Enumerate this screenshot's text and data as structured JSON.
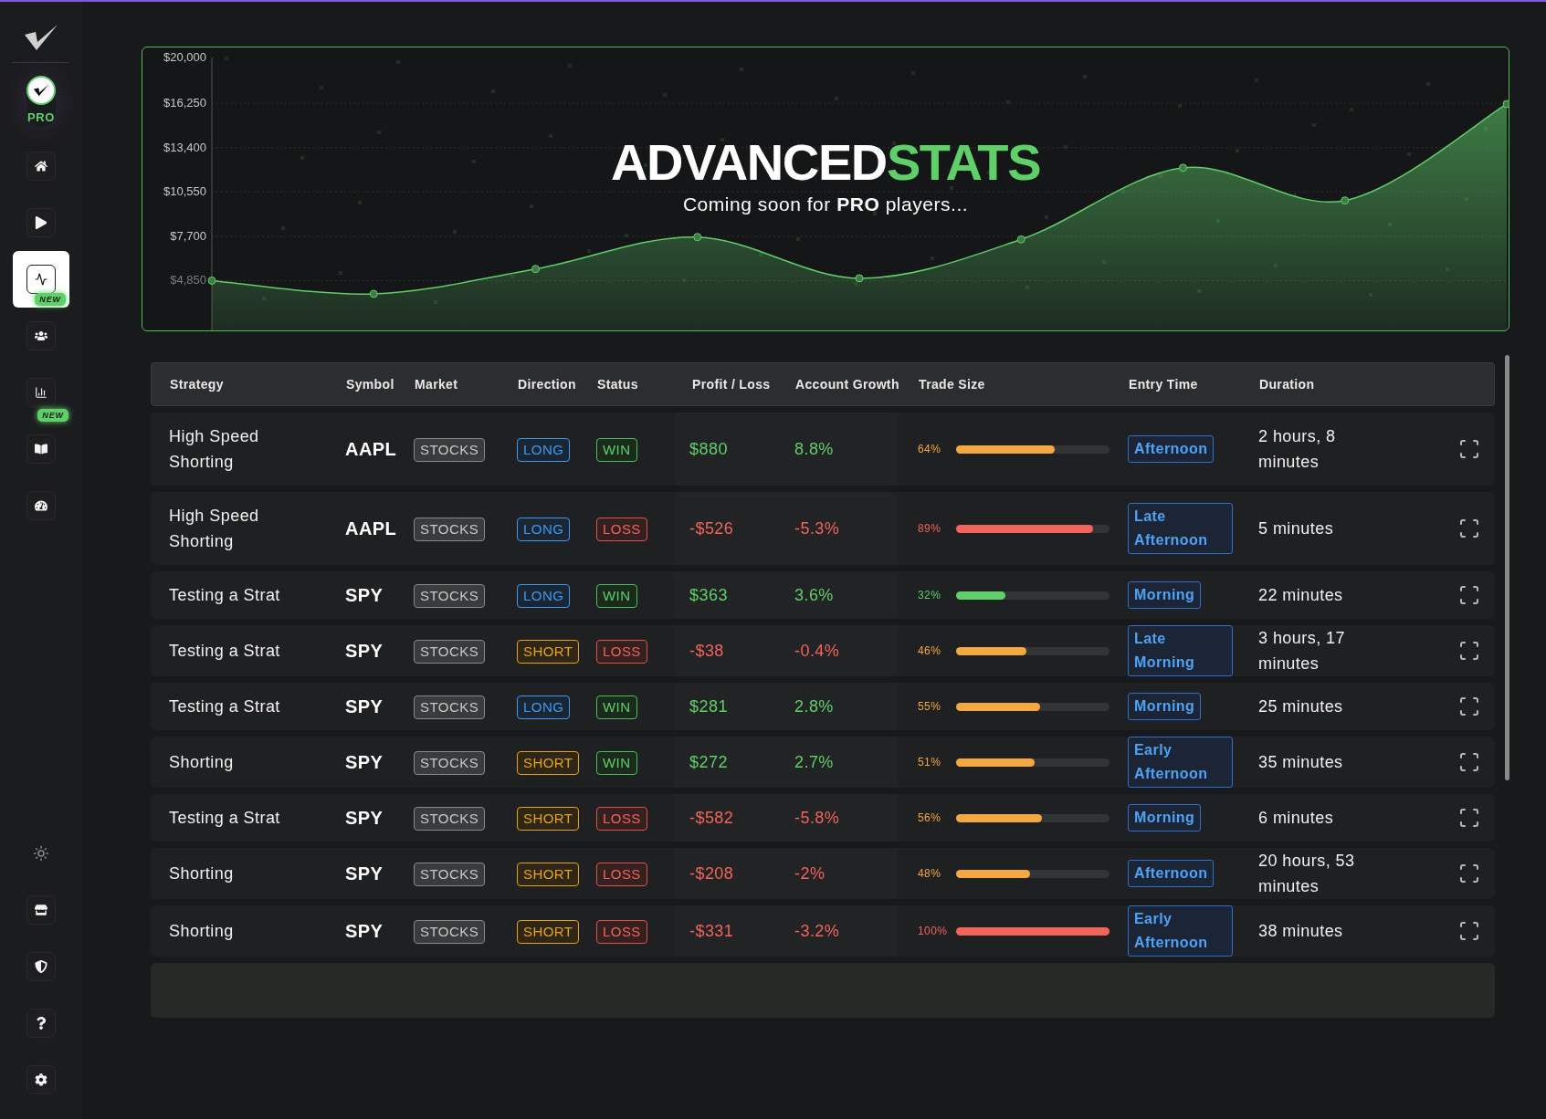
{
  "sidebar": {
    "pro_label": "PRO",
    "items": [
      {
        "kind": "home",
        "selected": false
      },
      {
        "kind": "play",
        "selected": false
      },
      {
        "kind": "activity",
        "selected": true,
        "badge": "NEW"
      },
      {
        "kind": "users",
        "selected": false
      },
      {
        "kind": "bars",
        "selected": false,
        "badge": "NEW"
      },
      {
        "kind": "book",
        "selected": false
      },
      {
        "kind": "gauge",
        "selected": false
      }
    ],
    "bottom_items": [
      {
        "kind": "sun"
      },
      {
        "kind": "store"
      },
      {
        "kind": "shield"
      },
      {
        "kind": "help"
      },
      {
        "kind": "settings"
      }
    ]
  },
  "banner": {
    "title_main": "ADVANCED",
    "title_accent": "STATS",
    "subtitle": "Coming soon for **PRO** players...",
    "y_axis_top_label": "$20,000",
    "chart_data": {
      "type": "area",
      "grid": true,
      "ylim": [
        1650,
        19190
      ],
      "series": [
        {
          "color": "#5fcf6a",
          "values": [
            4850,
            4000,
            5600,
            7650,
            5000,
            7500,
            12100,
            10000,
            16200
          ]
        }
      ],
      "yticks": [
        {
          "value": 4850,
          "label": "$4,850"
        },
        {
          "value": 7700,
          "label": "$7,700"
        },
        {
          "value": 10550,
          "label": "$10,550"
        },
        {
          "value": 13400,
          "label": "$13,400"
        },
        {
          "value": 16250,
          "label": "$16,250"
        }
      ]
    }
  },
  "table": {
    "columns": [
      "Strategy",
      "Symbol",
      "Market",
      "Direction",
      "Status",
      "Profit / Loss",
      "Account Growth",
      "Trade Size",
      "Entry Time",
      "Duration"
    ],
    "rows": [
      {
        "strategy": "High Speed Shorting",
        "symbol": "AAPL",
        "market": "STOCKS",
        "direction": {
          "label": "LONG",
          "kind": "long"
        },
        "status": {
          "label": "WIN",
          "kind": "win"
        },
        "profit_loss": "$880",
        "account_growth": "8.8%",
        "trade_size": {
          "reading": "64%",
          "level": 0.64,
          "color": "#f5a742"
        },
        "entry_time": "Afternoon",
        "duration": "2 hours, 8 minutes"
      },
      {
        "strategy": "High Speed Shorting",
        "symbol": "AAPL",
        "market": "STOCKS",
        "direction": {
          "label": "LONG",
          "kind": "long"
        },
        "status": {
          "label": "LOSS",
          "kind": "loss"
        },
        "profit_loss": "-$526",
        "account_growth": "-5.3%",
        "trade_size": {
          "reading": "89%",
          "level": 0.89,
          "color": "#f0645a"
        },
        "entry_time": "Late Afternoon",
        "duration": "5 minutes"
      },
      {
        "strategy": "Testing a Strat",
        "symbol": "SPY",
        "market": "STOCKS",
        "direction": {
          "label": "LONG",
          "kind": "long"
        },
        "status": {
          "label": "WIN",
          "kind": "win"
        },
        "profit_loss": "$363",
        "account_growth": "3.6%",
        "trade_size": {
          "reading": "32%",
          "level": 0.32,
          "color": "#5fcf6a"
        },
        "entry_time": "Morning",
        "duration": "22 minutes"
      },
      {
        "strategy": "Testing a Strat",
        "symbol": "SPY",
        "market": "STOCKS",
        "direction": {
          "label": "SHORT",
          "kind": "short"
        },
        "status": {
          "label": "LOSS",
          "kind": "loss"
        },
        "profit_loss": "-$38",
        "account_growth": "-0.4%",
        "trade_size": {
          "reading": "46%",
          "level": 0.46,
          "color": "#f5a742"
        },
        "entry_time": "Late Morning",
        "duration": "3 hours, 17 minutes"
      },
      {
        "strategy": "Testing a Strat",
        "symbol": "SPY",
        "market": "STOCKS",
        "direction": {
          "label": "LONG",
          "kind": "long"
        },
        "status": {
          "label": "WIN",
          "kind": "win"
        },
        "profit_loss": "$281",
        "account_growth": "2.8%",
        "trade_size": {
          "reading": "55%",
          "level": 0.55,
          "color": "#f5a742"
        },
        "entry_time": "Morning",
        "duration": "25 minutes"
      },
      {
        "strategy": "Shorting",
        "symbol": "SPY",
        "market": "STOCKS",
        "direction": {
          "label": "SHORT",
          "kind": "short"
        },
        "status": {
          "label": "WIN",
          "kind": "win"
        },
        "profit_loss": "$272",
        "account_growth": "2.7%",
        "trade_size": {
          "reading": "51%",
          "level": 0.51,
          "color": "#f5a742"
        },
        "entry_time": "Early Afternoon",
        "duration": "35 minutes"
      },
      {
        "strategy": "Testing a Strat",
        "symbol": "SPY",
        "market": "STOCKS",
        "direction": {
          "label": "SHORT",
          "kind": "short"
        },
        "status": {
          "label": "LOSS",
          "kind": "loss"
        },
        "profit_loss": "-$582",
        "account_growth": "-5.8%",
        "trade_size": {
          "reading": "56%",
          "level": 0.56,
          "color": "#f5a742"
        },
        "entry_time": "Morning",
        "duration": "6 minutes"
      },
      {
        "strategy": "Shorting",
        "symbol": "SPY",
        "market": "STOCKS",
        "direction": {
          "label": "SHORT",
          "kind": "short"
        },
        "status": {
          "label": "LOSS",
          "kind": "loss"
        },
        "profit_loss": "-$208",
        "account_growth": "-2%",
        "trade_size": {
          "reading": "48%",
          "level": 0.48,
          "color": "#f5a742"
        },
        "entry_time": "Afternoon",
        "duration": "20 hours, 53 minutes"
      },
      {
        "strategy": "Shorting",
        "symbol": "SPY",
        "market": "STOCKS",
        "direction": {
          "label": "SHORT",
          "kind": "short"
        },
        "status": {
          "label": "LOSS",
          "kind": "loss"
        },
        "profit_loss": "-$331",
        "account_growth": "-3.2%",
        "trade_size": {
          "reading": "100%",
          "level": 1,
          "color": "#f0645a"
        },
        "entry_time": "Early Afternoon",
        "duration": "38 minutes"
      }
    ]
  }
}
